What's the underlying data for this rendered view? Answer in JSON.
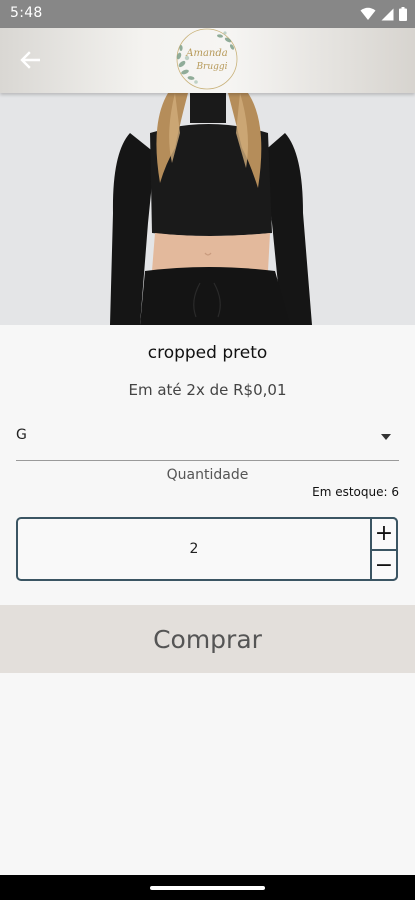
{
  "status_bar": {
    "time": "5:48",
    "icons": [
      "wifi-icon",
      "signal-icon",
      "battery-icon"
    ]
  },
  "app_bar": {
    "back_icon": "arrow-left-icon",
    "logo_text_line1": "Amanda",
    "logo_text_line2": "Bruggi"
  },
  "product": {
    "name": "cropped preto",
    "price_text": "Em até 2x de R$0,01",
    "selected_size": "G",
    "quantity_label": "Quantidade",
    "stock_text": "Em estoque: 6",
    "quantity": "2",
    "plus_label": "+",
    "minus_label": "−"
  },
  "actions": {
    "buy_label": "Comprar"
  },
  "colors": {
    "status_bar_bg": "#878787",
    "accent_border": "#3b5563",
    "buy_button_bg": "#e3dfdb",
    "page_bg": "#f7f7f7"
  }
}
